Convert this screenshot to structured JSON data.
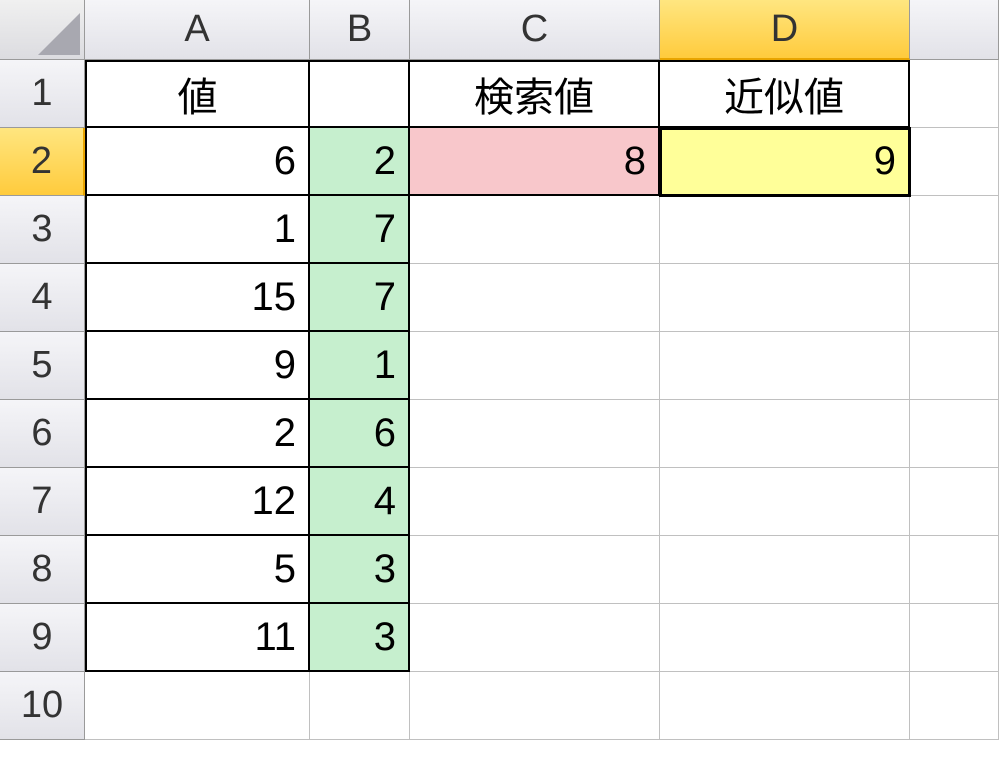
{
  "columns": [
    "A",
    "B",
    "C",
    "D",
    ""
  ],
  "rows": [
    "1",
    "2",
    "3",
    "4",
    "5",
    "6",
    "7",
    "8",
    "9",
    "10"
  ],
  "headers": {
    "A1": "値",
    "C1": "検索値",
    "D1": "近似値"
  },
  "cells": {
    "A2": "6",
    "B2": "2",
    "C2": "8",
    "D2": "9",
    "A3": "1",
    "B3": "7",
    "A4": "15",
    "B4": "7",
    "A5": "9",
    "B5": "1",
    "A6": "2",
    "B6": "6",
    "A7": "12",
    "B7": "4",
    "A8": "5",
    "B8": "3",
    "A9": "11",
    "B9": "3"
  },
  "selected": {
    "column": "D",
    "row": "2",
    "cell": "D2"
  }
}
